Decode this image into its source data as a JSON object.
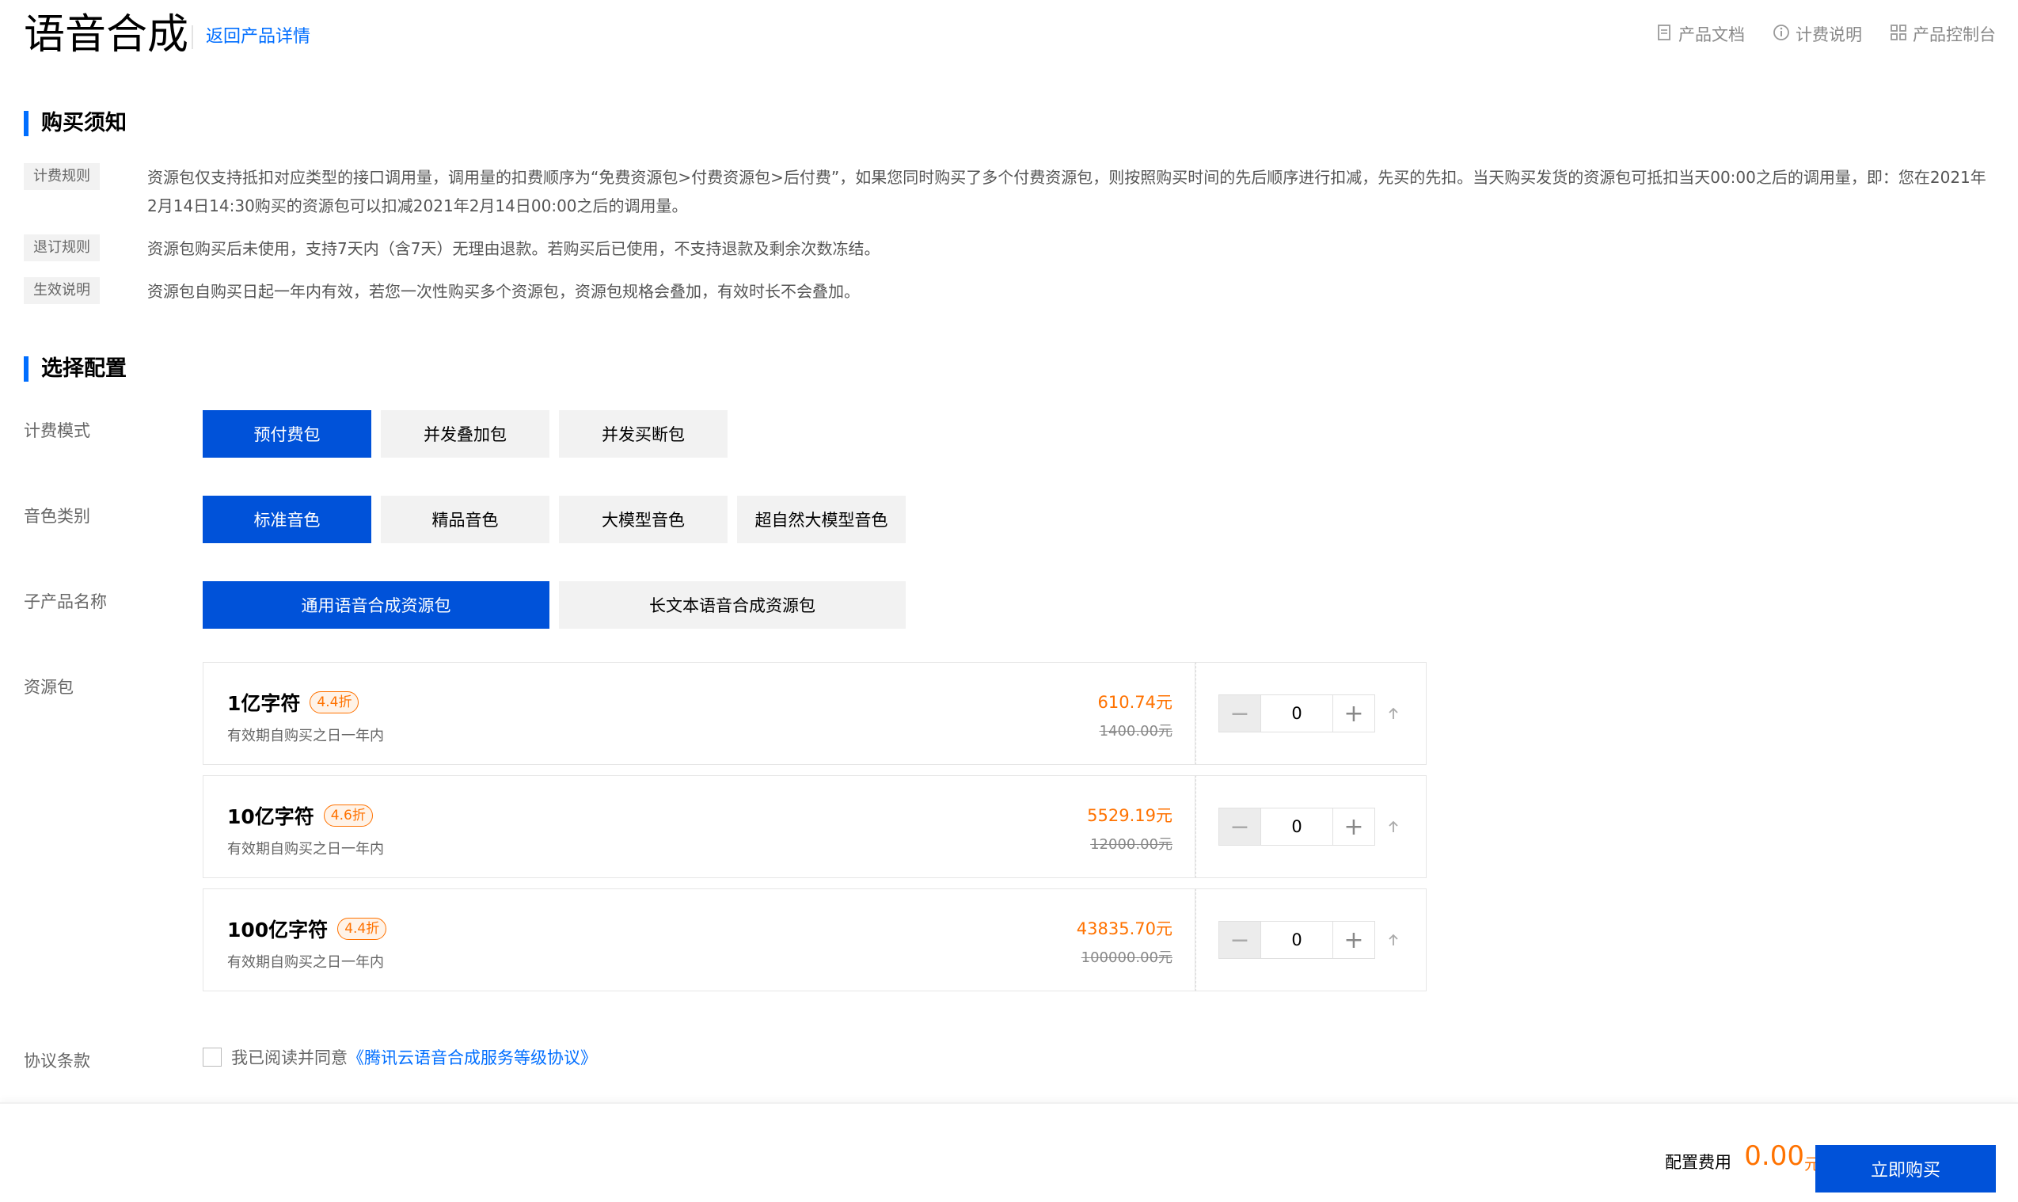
{
  "header": {
    "title": "语音合成",
    "back_link": "返回产品详情",
    "links": [
      {
        "label": "产品文档",
        "icon": "document-icon"
      },
      {
        "label": "计费说明",
        "icon": "info-icon"
      },
      {
        "label": "产品控制台",
        "icon": "grid-icon"
      }
    ]
  },
  "purchase_notice": {
    "title": "购买须知",
    "rules": [
      {
        "tag": "计费规则",
        "text": "资源包仅支持抵扣对应类型的接口调用量，调用量的扣费顺序为“免费资源包>付费资源包>后付费”，如果您同时购买了多个付费资源包，则按照购买时间的先后顺序进行扣减，先买的先扣。当天购买发货的资源包可抵扣当天00:00之后的调用量，即：您在2021年2月14日14:30购买的资源包可以扣减2021年2月14日00:00之后的调用量。"
      },
      {
        "tag": "退订规则",
        "text": "资源包购买后未使用，支持7天内（含7天）无理由退款。若购买后已使用，不支持退款及剩余次数冻结。"
      },
      {
        "tag": "生效说明",
        "text": "资源包自购买日起一年内有效，若您一次性购买多个资源包，资源包规格会叠加，有效时长不会叠加。"
      }
    ]
  },
  "config": {
    "title": "选择配置",
    "billing_mode": {
      "label": "计费模式",
      "options": [
        "预付费包",
        "并发叠加包",
        "并发买断包"
      ],
      "selected": 0
    },
    "voice_type": {
      "label": "音色类别",
      "options": [
        "标准音色",
        "精品音色",
        "大模型音色",
        "超自然大模型音色"
      ],
      "selected": 0
    },
    "sub_product": {
      "label": "子产品名称",
      "options": [
        "通用语音合成资源包",
        "长文本语音合成资源包"
      ],
      "selected": 0
    },
    "packages": {
      "label": "资源包",
      "items": [
        {
          "name": "1亿字符",
          "discount": "4.4折",
          "desc": "有效期自购买之日一年内",
          "price": "610.74元",
          "original": "1400.00元",
          "qty": "0"
        },
        {
          "name": "10亿字符",
          "discount": "4.6折",
          "desc": "有效期自购买之日一年内",
          "price": "5529.19元",
          "original": "12000.00元",
          "qty": "0"
        },
        {
          "name": "100亿字符",
          "discount": "4.4折",
          "desc": "有效期自购买之日一年内",
          "price": "43835.70元",
          "original": "100000.00元",
          "qty": "0"
        }
      ]
    },
    "agreement": {
      "label": "协议条款",
      "text": "我已阅读并同意",
      "link": "《腾讯云语音合成服务等级协议》",
      "checked": false
    }
  },
  "footer": {
    "fee_label": "配置费用",
    "fee_value": "0.00",
    "fee_unit": "元",
    "buy_button": "立即购买"
  },
  "colors": {
    "primary": "#0052d9",
    "link": "#006eff",
    "price": "#ff7200"
  }
}
